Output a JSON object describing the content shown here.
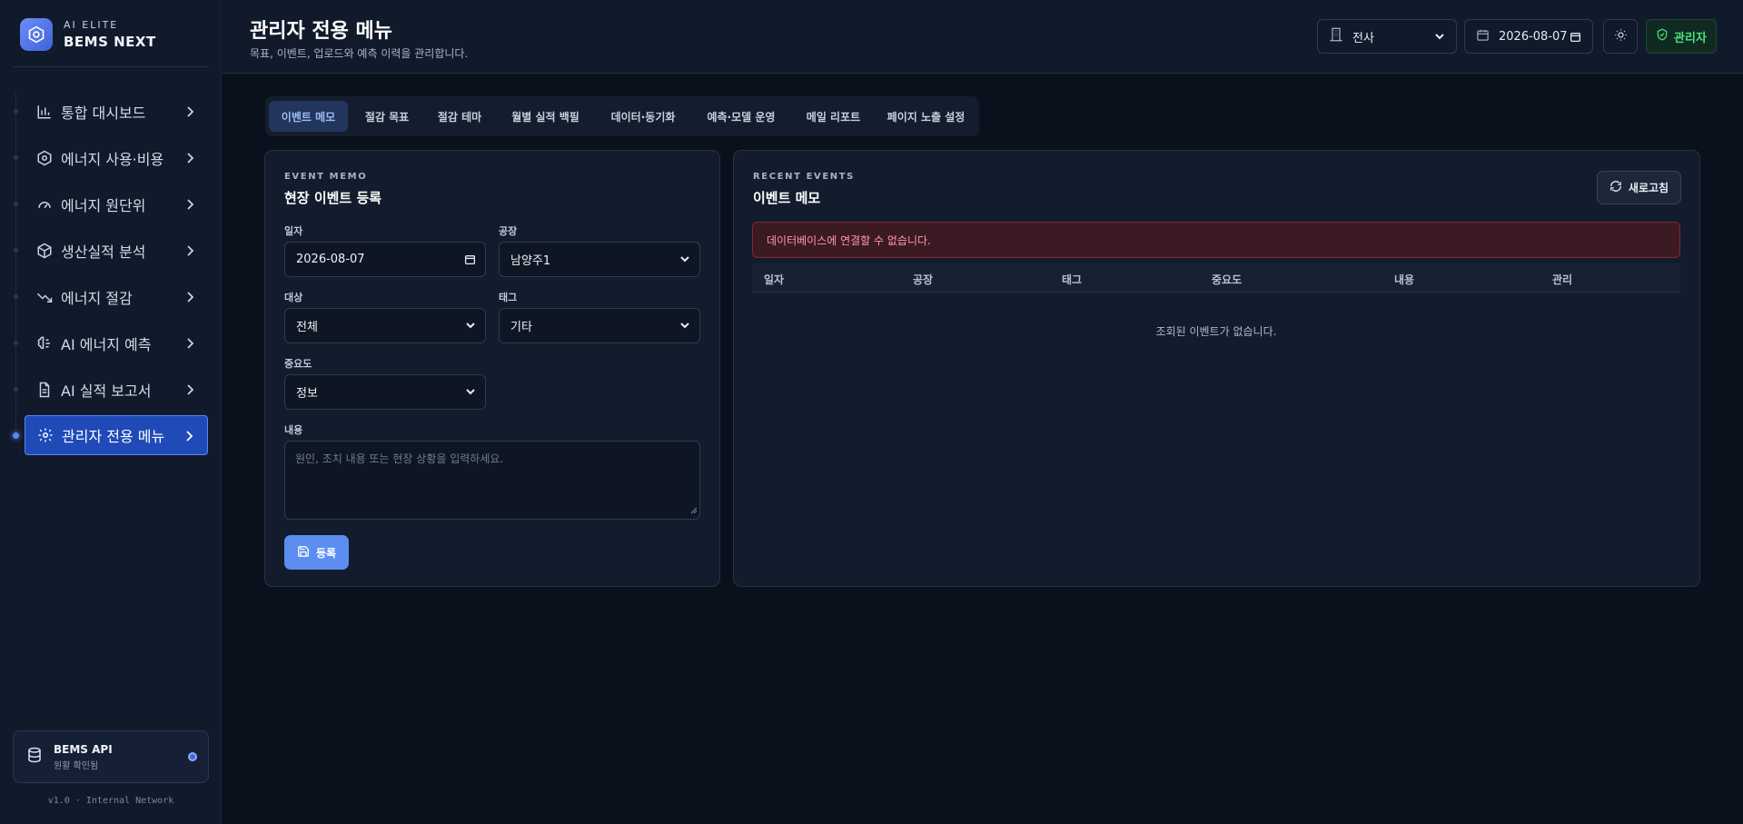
{
  "brand": {
    "sub": "AI ELITE",
    "main": "BEMS NEXT"
  },
  "sidebar": {
    "items": [
      {
        "label": "통합 대시보드",
        "icon": "bar-chart-icon"
      },
      {
        "label": "에너지 사용·비용",
        "icon": "hexagon-icon"
      },
      {
        "label": "에너지 원단위",
        "icon": "gauge-icon"
      },
      {
        "label": "생산실적 분석",
        "icon": "box-icon"
      },
      {
        "label": "에너지 절감",
        "icon": "trending-down-icon"
      },
      {
        "label": "AI 에너지 예측",
        "icon": "brain-icon"
      },
      {
        "label": "AI 실적 보고서",
        "icon": "file-text-icon"
      },
      {
        "label": "관리자 전용 메뉴",
        "icon": "gear-icon",
        "active": true
      }
    ],
    "api_card": {
      "title": "BEMS API",
      "status": "원활 확인됨"
    },
    "version": "v1.0 · Internal Network"
  },
  "header": {
    "title": "관리자 전용 메뉴",
    "subtitle": "목표, 이벤트, 업로드와 예측 이력을 관리합니다.",
    "site_select": "전사",
    "date": "2026-08-07",
    "admin_label": "관리자"
  },
  "tabs": [
    "이벤트 메모",
    "절감 목표",
    "절감 테마",
    "월별 실적 백필",
    "데이터·동기화",
    "예측·모델 운영",
    "메일 리포트",
    "페이지 노출 설정"
  ],
  "form": {
    "eyebrow": "EVENT MEMO",
    "title": "현장 이벤트 등록",
    "date_label": "일자",
    "date_value": "2026-08-07",
    "plant_label": "공장",
    "plant_value": "남양주1",
    "target_label": "대상",
    "target_value": "전체",
    "tag_label": "태그",
    "tag_value": "기타",
    "severity_label": "중요도",
    "severity_value": "정보",
    "content_label": "내용",
    "content_placeholder": "원인, 조치 내용 또는 현장 상황을 입력하세요.",
    "submit_label": "등록"
  },
  "events": {
    "eyebrow": "RECENT EVENTS",
    "title": "이벤트 메모",
    "refresh_label": "새로고침",
    "error": "데이터베이스에 연결할 수 없습니다.",
    "columns": [
      "일자",
      "공장",
      "태그",
      "중요도",
      "내용",
      "관리"
    ],
    "empty": "조회된 이벤트가 없습니다."
  },
  "colors": {
    "accent": "#5c8df0",
    "active_nav": "#1f4ab8",
    "admin": "#4ade80",
    "error": "#ff9aa6"
  }
}
